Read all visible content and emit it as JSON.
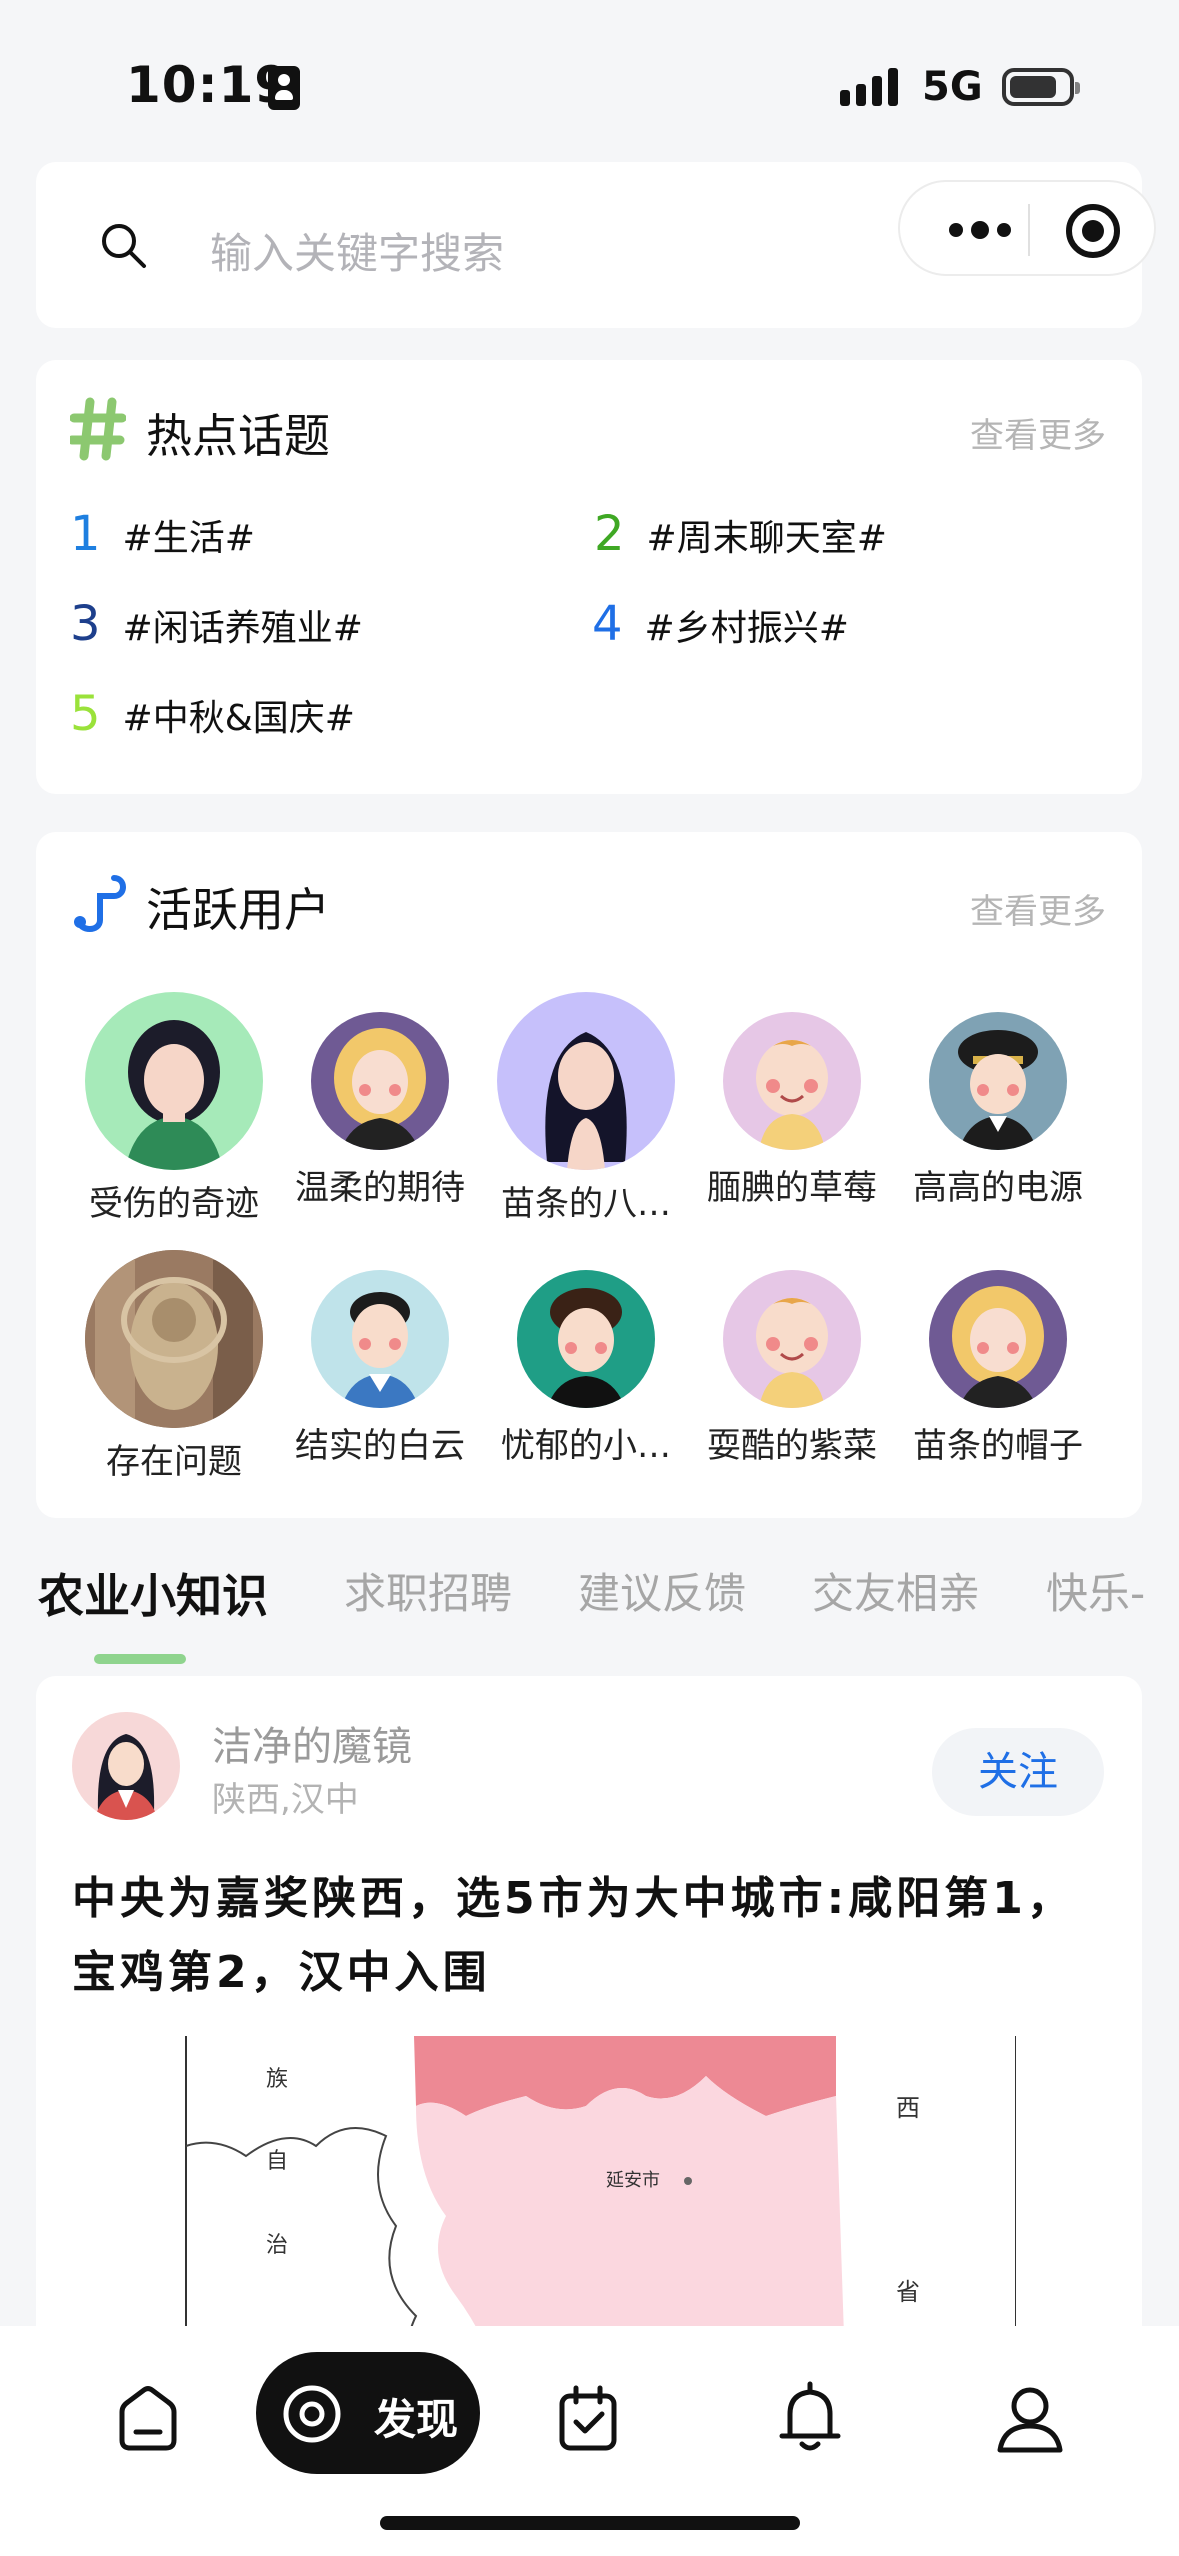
{
  "status_bar": {
    "time": "10:19",
    "network": "5G"
  },
  "search": {
    "placeholder": "输入关键字搜索"
  },
  "hot_topics": {
    "title": "热点话题",
    "more": "查看更多",
    "items": [
      {
        "num": "1",
        "label": "#生活#",
        "color": "#1e7fe0"
      },
      {
        "num": "2",
        "label": "#周末聊天室#",
        "color": "#3fa824"
      },
      {
        "num": "3",
        "label": "#闲话养殖业#",
        "color": "#1d3f8c"
      },
      {
        "num": "4",
        "label": "#乡村振兴#",
        "color": "#1f6fe6"
      },
      {
        "num": "5",
        "label": "#中秋&国庆#",
        "color": "#9ae23a"
      }
    ]
  },
  "active_users": {
    "title": "活跃用户",
    "more": "查看更多",
    "users": [
      {
        "name": "受伤的奇迹"
      },
      {
        "name": "温柔的期待"
      },
      {
        "name": "苗条的八…"
      },
      {
        "name": "腼腆的草莓"
      },
      {
        "name": "高高的电源"
      },
      {
        "name": "存在问题"
      },
      {
        "name": "结实的白云"
      },
      {
        "name": "忧郁的小…"
      },
      {
        "name": "耍酷的紫菜"
      },
      {
        "name": "苗条的帽子"
      }
    ]
  },
  "tabs": [
    "农业小知识",
    "求职招聘",
    "建议反馈",
    "交友相亲",
    "快乐-"
  ],
  "post": {
    "author": "洁净的魔镜",
    "location": "陕西,汉中",
    "follow_label": "关注",
    "title": "中央为嘉奖陕西，选5市为大中城市:咸阳第1，宝鸡第2，汉中入围",
    "map_labels": {
      "left_1": "族",
      "left_2": "自",
      "left_3": "治",
      "right_1": "西",
      "right_2": "省",
      "city": "延安市"
    }
  },
  "bottom_nav": {
    "discover_label": "发现"
  },
  "colors": {
    "accent_green": "#8fd48e",
    "link_blue": "#1f6fe6",
    "hash_green": "#8cc870"
  }
}
